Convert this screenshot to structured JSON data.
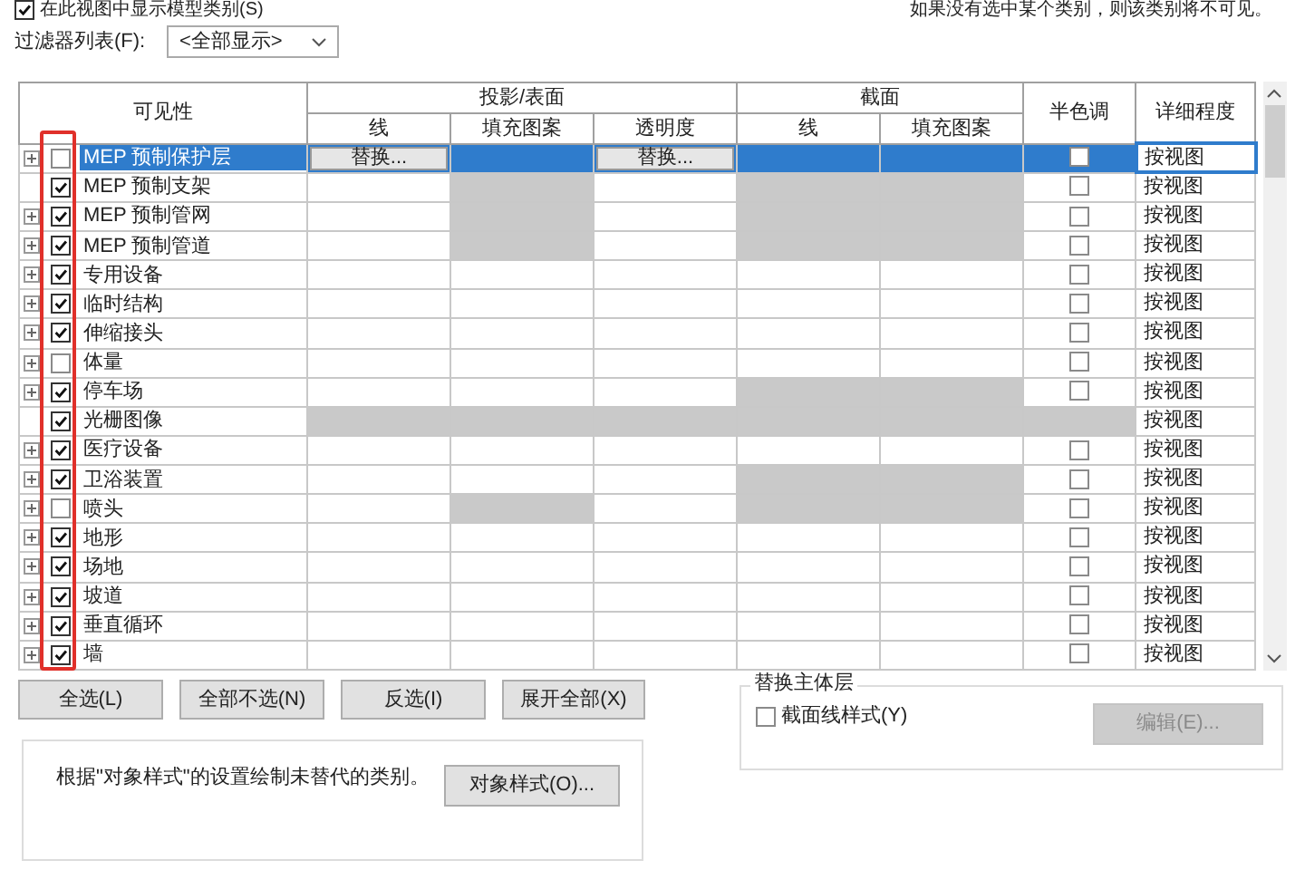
{
  "top_checkbox": {
    "label": "在此视图中显示模型类别(S)",
    "checked": true
  },
  "top_note": "如果没有选中某个类别，则该类别将不可见。",
  "filter": {
    "label": "过滤器列表(F):",
    "value": "<全部显示>"
  },
  "table": {
    "header_groups": [
      {
        "label": "可见性"
      },
      {
        "label": "投影/表面",
        "columns": [
          "线",
          "填充图案",
          "透明度"
        ]
      },
      {
        "label": "截面",
        "columns": [
          "线",
          "填充图案"
        ]
      },
      {
        "label": "半色调"
      },
      {
        "label": "详细程度"
      }
    ],
    "rows": [
      {
        "name": "MEP 预制保护层",
        "visible": false,
        "expandable": true,
        "selected": true,
        "projection": [
          {
            "unavailable": false,
            "text": "替换..."
          },
          {
            "unavailable": true
          },
          {
            "unavailable": false,
            "text": "替换..."
          }
        ],
        "cut": [
          {
            "unavailable": true
          },
          {
            "unavailable": true
          }
        ],
        "halftone": {
          "unavailable": false,
          "checked": false
        },
        "detail": "按视图"
      },
      {
        "name": "MEP 预制支架",
        "visible": true,
        "expandable": false,
        "selected": false,
        "projection": [
          {
            "unavailable": false
          },
          {
            "unavailable": true
          },
          {
            "unavailable": false
          }
        ],
        "cut": [
          {
            "unavailable": true
          },
          {
            "unavailable": true
          }
        ],
        "halftone": {
          "unavailable": false,
          "checked": false
        },
        "detail": "按视图"
      },
      {
        "name": "MEP 预制管网",
        "visible": true,
        "expandable": true,
        "selected": false,
        "projection": [
          {
            "unavailable": false
          },
          {
            "unavailable": true
          },
          {
            "unavailable": false
          }
        ],
        "cut": [
          {
            "unavailable": true
          },
          {
            "unavailable": true
          }
        ],
        "halftone": {
          "unavailable": false,
          "checked": false
        },
        "detail": "按视图"
      },
      {
        "name": "MEP 预制管道",
        "visible": true,
        "expandable": true,
        "selected": false,
        "projection": [
          {
            "unavailable": false
          },
          {
            "unavailable": true
          },
          {
            "unavailable": false
          }
        ],
        "cut": [
          {
            "unavailable": true
          },
          {
            "unavailable": true
          }
        ],
        "halftone": {
          "unavailable": false,
          "checked": false
        },
        "detail": "按视图"
      },
      {
        "name": "专用设备",
        "visible": true,
        "expandable": true,
        "selected": false,
        "projection": [
          {
            "unavailable": false
          },
          {
            "unavailable": false
          },
          {
            "unavailable": false
          }
        ],
        "cut": [
          {
            "unavailable": false
          },
          {
            "unavailable": false
          }
        ],
        "halftone": {
          "unavailable": false,
          "checked": false
        },
        "detail": "按视图"
      },
      {
        "name": "临时结构",
        "visible": true,
        "expandable": true,
        "selected": false,
        "projection": [
          {
            "unavailable": false
          },
          {
            "unavailable": false
          },
          {
            "unavailable": false
          }
        ],
        "cut": [
          {
            "unavailable": false
          },
          {
            "unavailable": false
          }
        ],
        "halftone": {
          "unavailable": false,
          "checked": false
        },
        "detail": "按视图"
      },
      {
        "name": "伸缩接头",
        "visible": true,
        "expandable": true,
        "selected": false,
        "projection": [
          {
            "unavailable": false
          },
          {
            "unavailable": false
          },
          {
            "unavailable": false
          }
        ],
        "cut": [
          {
            "unavailable": false
          },
          {
            "unavailable": false
          }
        ],
        "halftone": {
          "unavailable": false,
          "checked": false
        },
        "detail": "按视图"
      },
      {
        "name": "体量",
        "visible": false,
        "expandable": true,
        "selected": false,
        "projection": [
          {
            "unavailable": false
          },
          {
            "unavailable": false
          },
          {
            "unavailable": false
          }
        ],
        "cut": [
          {
            "unavailable": false
          },
          {
            "unavailable": false
          }
        ],
        "halftone": {
          "unavailable": false,
          "checked": false
        },
        "detail": "按视图"
      },
      {
        "name": "停车场",
        "visible": true,
        "expandable": true,
        "selected": false,
        "projection": [
          {
            "unavailable": false
          },
          {
            "unavailable": false
          },
          {
            "unavailable": false
          }
        ],
        "cut": [
          {
            "unavailable": true
          },
          {
            "unavailable": true
          }
        ],
        "halftone": {
          "unavailable": false,
          "checked": false
        },
        "detail": "按视图"
      },
      {
        "name": "光栅图像",
        "visible": true,
        "expandable": false,
        "selected": false,
        "projection": [
          {
            "unavailable": true
          },
          {
            "unavailable": true
          },
          {
            "unavailable": true
          }
        ],
        "cut": [
          {
            "unavailable": true
          },
          {
            "unavailable": true
          }
        ],
        "halftone": {
          "unavailable": true
        },
        "detail": "按视图"
      },
      {
        "name": "医疗设备",
        "visible": true,
        "expandable": true,
        "selected": false,
        "projection": [
          {
            "unavailable": false
          },
          {
            "unavailable": false
          },
          {
            "unavailable": false
          }
        ],
        "cut": [
          {
            "unavailable": false
          },
          {
            "unavailable": false
          }
        ],
        "halftone": {
          "unavailable": false,
          "checked": false
        },
        "detail": "按视图"
      },
      {
        "name": "卫浴装置",
        "visible": true,
        "expandable": true,
        "selected": false,
        "projection": [
          {
            "unavailable": false
          },
          {
            "unavailable": false
          },
          {
            "unavailable": false
          }
        ],
        "cut": [
          {
            "unavailable": true
          },
          {
            "unavailable": true
          }
        ],
        "halftone": {
          "unavailable": false,
          "checked": false
        },
        "detail": "按视图"
      },
      {
        "name": "喷头",
        "visible": false,
        "expandable": true,
        "selected": false,
        "projection": [
          {
            "unavailable": false
          },
          {
            "unavailable": true
          },
          {
            "unavailable": false
          }
        ],
        "cut": [
          {
            "unavailable": true
          },
          {
            "unavailable": true
          }
        ],
        "halftone": {
          "unavailable": false,
          "checked": false
        },
        "detail": "按视图"
      },
      {
        "name": "地形",
        "visible": true,
        "expandable": true,
        "selected": false,
        "projection": [
          {
            "unavailable": false
          },
          {
            "unavailable": false
          },
          {
            "unavailable": false
          }
        ],
        "cut": [
          {
            "unavailable": false
          },
          {
            "unavailable": false
          }
        ],
        "halftone": {
          "unavailable": false,
          "checked": false
        },
        "detail": "按视图"
      },
      {
        "name": "场地",
        "visible": true,
        "expandable": true,
        "selected": false,
        "projection": [
          {
            "unavailable": false
          },
          {
            "unavailable": false
          },
          {
            "unavailable": false
          }
        ],
        "cut": [
          {
            "unavailable": false
          },
          {
            "unavailable": false
          }
        ],
        "halftone": {
          "unavailable": false,
          "checked": false
        },
        "detail": "按视图"
      },
      {
        "name": "坡道",
        "visible": true,
        "expandable": true,
        "selected": false,
        "projection": [
          {
            "unavailable": false
          },
          {
            "unavailable": false
          },
          {
            "unavailable": false
          }
        ],
        "cut": [
          {
            "unavailable": false
          },
          {
            "unavailable": false
          }
        ],
        "halftone": {
          "unavailable": false,
          "checked": false
        },
        "detail": "按视图"
      },
      {
        "name": "垂直循环",
        "visible": true,
        "expandable": true,
        "selected": false,
        "projection": [
          {
            "unavailable": false
          },
          {
            "unavailable": false
          },
          {
            "unavailable": false
          }
        ],
        "cut": [
          {
            "unavailable": false
          },
          {
            "unavailable": false
          }
        ],
        "halftone": {
          "unavailable": false,
          "checked": false
        },
        "detail": "按视图"
      },
      {
        "name": "墙",
        "visible": true,
        "expandable": true,
        "selected": false,
        "projection": [
          {
            "unavailable": false
          },
          {
            "unavailable": false
          },
          {
            "unavailable": false
          }
        ],
        "cut": [
          {
            "unavailable": false
          },
          {
            "unavailable": false
          }
        ],
        "halftone": {
          "unavailable": false,
          "checked": false
        },
        "detail": "按视图"
      }
    ]
  },
  "buttons": [
    "全选(L)",
    "全部不选(N)",
    "反选(I)",
    "展开全部(X)"
  ],
  "note": {
    "text": "根据\"对象样式\"的设置绘制未替代的类别。",
    "button": "对象样式(O)..."
  },
  "host_layers": {
    "title": "替换主体层",
    "checkbox": {
      "label": "截面线样式(Y)",
      "checked": false
    },
    "button": {
      "label": "编辑(E)...",
      "disabled": true
    }
  }
}
